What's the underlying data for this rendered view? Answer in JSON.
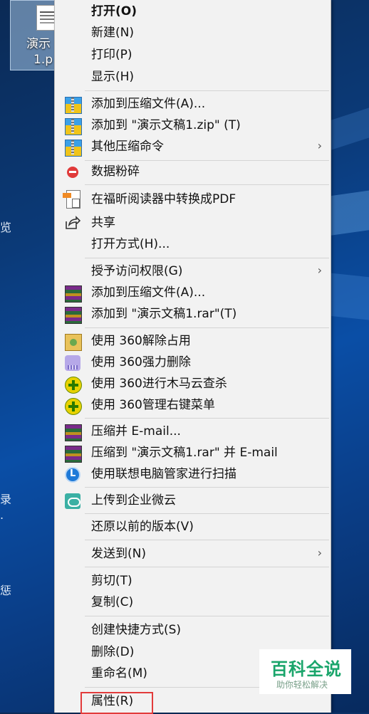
{
  "desktop": {
    "icon_label_line1": "演示",
    "icon_label_line2": "1.p",
    "edge_chars": [
      "览",
      "录",
      ".",
      "惩"
    ]
  },
  "menu": {
    "items": [
      {
        "label": "打开(O)",
        "bold": true
      },
      {
        "label": "新建(N)"
      },
      {
        "label": "打印(P)"
      },
      {
        "label": "显示(H)"
      },
      {
        "label": "添加到压缩文件(A)...",
        "icon": "zip-archive-icon"
      },
      {
        "label": "添加到 \"演示文稿1.zip\" (T)",
        "icon": "zip-archive-icon"
      },
      {
        "label": "其他压缩命令",
        "icon": "zip-archive-icon",
        "submenu": true
      },
      {
        "label": "数据粉碎",
        "icon": "stop-icon"
      },
      {
        "label": "在福昕阅读器中转换成PDF",
        "icon": "pdf-convert-icon"
      },
      {
        "label": "共享",
        "icon": "share-icon"
      },
      {
        "label": "打开方式(H)..."
      },
      {
        "label": "授予访问权限(G)",
        "submenu": true
      },
      {
        "label": "添加到压缩文件(A)...",
        "icon": "rar-icon"
      },
      {
        "label": "添加到 \"演示文稿1.rar\"(T)",
        "icon": "rar-icon"
      },
      {
        "label": "使用 360解除占用",
        "icon": "unlock-360-icon"
      },
      {
        "label": "使用 360强力删除",
        "icon": "shredder-360-icon"
      },
      {
        "label": "使用 360进行木马云查杀",
        "icon": "plus-360-icon"
      },
      {
        "label": "使用 360管理右键菜单",
        "icon": "plus-360-icon"
      },
      {
        "label": "压缩并 E-mail...",
        "icon": "rar-icon"
      },
      {
        "label": "压缩到 \"演示文稿1.rar\" 并 E-mail",
        "icon": "rar-icon"
      },
      {
        "label": "使用联想电脑管家进行扫描",
        "icon": "lenovo-icon"
      },
      {
        "label": "上传到企业微云",
        "icon": "cloud-icon"
      },
      {
        "label": "还原以前的版本(V)"
      },
      {
        "label": "发送到(N)",
        "submenu": true
      },
      {
        "label": "剪切(T)"
      },
      {
        "label": "复制(C)"
      },
      {
        "label": "创建快捷方式(S)"
      },
      {
        "label": "删除(D)"
      },
      {
        "label": "重命名(M)"
      },
      {
        "label": "属性(R)",
        "highlighted": true
      }
    ]
  },
  "watermark": {
    "title": "百科全说",
    "subtitle": "助你轻松解决"
  },
  "colors": {
    "menu_bg": "#f2f2f2",
    "highlight_border": "#e23b3b",
    "watermark_green": "#1aa56b"
  }
}
